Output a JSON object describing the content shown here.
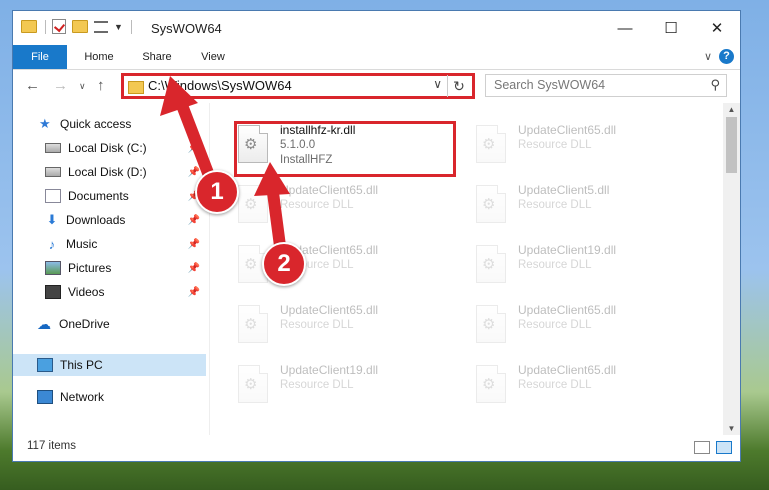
{
  "window": {
    "title": "SysWOW64"
  },
  "ribbon": {
    "tabs": [
      "File",
      "Home",
      "Share",
      "View"
    ]
  },
  "address": {
    "path": "C:\\Windows\\SysWOW64"
  },
  "search": {
    "placeholder": "Search SysWOW64"
  },
  "sidebar": {
    "items": [
      {
        "label": "Quick access",
        "icon": "star-icon",
        "pinned": false
      },
      {
        "label": "Local Disk (C:)",
        "icon": "disk-icon",
        "pinned": true
      },
      {
        "label": "Local Disk (D:)",
        "icon": "disk-icon",
        "pinned": true
      },
      {
        "label": "Documents",
        "icon": "documents-icon",
        "pinned": true
      },
      {
        "label": "Downloads",
        "icon": "download-icon",
        "pinned": true
      },
      {
        "label": "Music",
        "icon": "music-icon",
        "pinned": true
      },
      {
        "label": "Pictures",
        "icon": "pictures-icon",
        "pinned": true
      },
      {
        "label": "Videos",
        "icon": "videos-icon",
        "pinned": true
      },
      {
        "label": "OneDrive",
        "icon": "onedrive-icon",
        "pinned": false
      },
      {
        "label": "This PC",
        "icon": "computer-icon",
        "pinned": false,
        "selected": true
      },
      {
        "label": "Network",
        "icon": "network-icon",
        "pinned": false
      }
    ]
  },
  "files": [
    {
      "name": "installhfz-kr.dll",
      "line2": "5.1.0.0",
      "line3": "InstallHFZ",
      "highlighted": true
    },
    {
      "name": "UpdateClient65.dll",
      "line2": "Resource DLL"
    },
    {
      "name": "UpdateClient65.dll",
      "line2": "Resource DLL"
    },
    {
      "name": "UpdateClient5.dll",
      "line2": "Resource DLL"
    },
    {
      "name": "UpdateClient65.dll",
      "line2": "Resource DLL"
    },
    {
      "name": "UpdateClient19.dll",
      "line2": "Resource DLL"
    },
    {
      "name": "UpdateClient65.dll",
      "line2": "Resource DLL"
    },
    {
      "name": "UpdateClient65.dll",
      "line2": "Resource DLL"
    },
    {
      "name": "UpdateClient19.dll",
      "line2": "Resource DLL"
    },
    {
      "name": "UpdateClient65.dll",
      "line2": "Resource DLL"
    }
  ],
  "status": {
    "count": "117 items"
  },
  "annotations": {
    "step1": "1",
    "step2": "2"
  },
  "colors": {
    "accent": "#1979ca",
    "annotation": "#d9262c",
    "selection": "#cce4f7"
  }
}
